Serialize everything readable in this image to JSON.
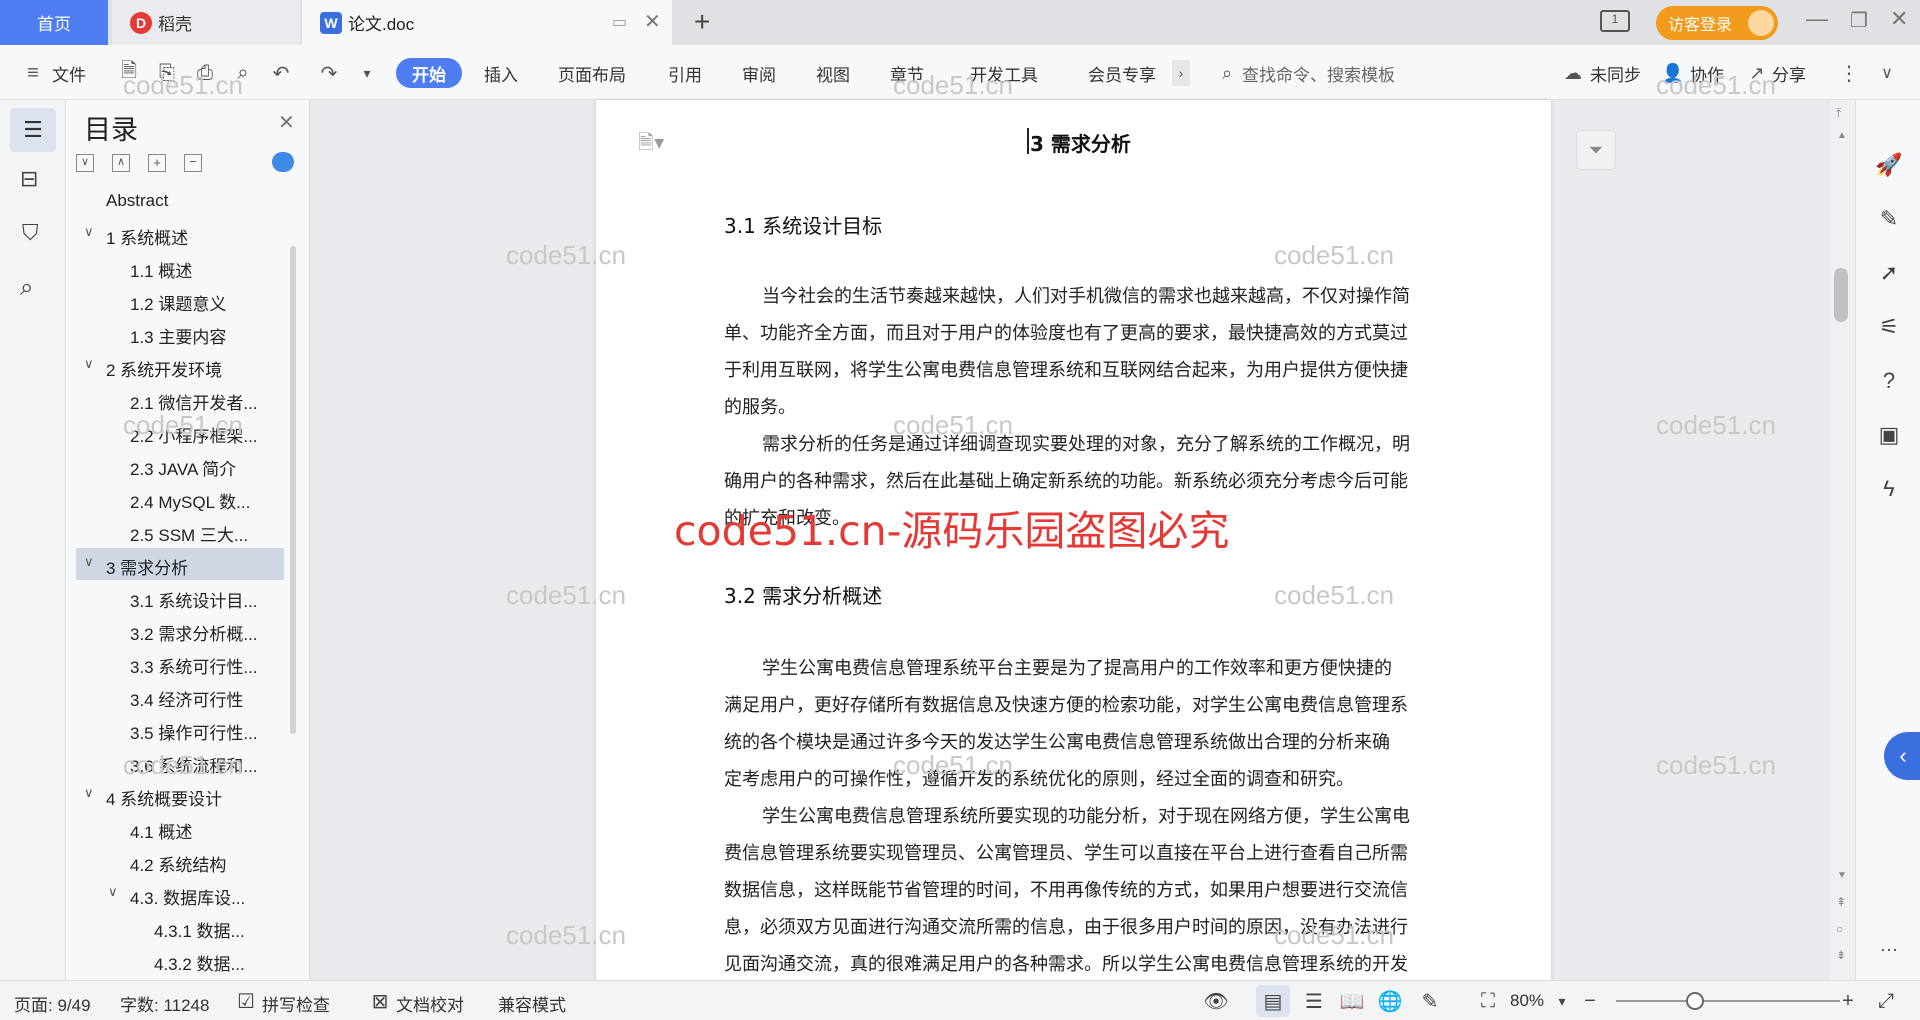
{
  "tabs": {
    "home": "首页",
    "daoke": "稻壳",
    "doc": "论文.doc",
    "new_tab": "+"
  },
  "titlebar": {
    "login": "访客登录"
  },
  "toolbar": {
    "file": "文件",
    "menus": [
      "开始",
      "插入",
      "页面布局",
      "引用",
      "审阅",
      "视图",
      "章节",
      "开发工具",
      "会员专享"
    ],
    "search_placeholder": "查找命令、搜索模板",
    "sync": "未同步",
    "collab": "协作",
    "share": "分享"
  },
  "toc": {
    "title": "目录",
    "items": [
      "Abstract",
      "1  系统概述",
      "1.1  概述",
      "1.2 课题意义",
      "1.3  主要内容",
      "2  系统开发环境",
      "2.1 微信开发者...",
      "2.2 小程序框架...",
      "2.3 JAVA 简介",
      "2.4 MySQL 数...",
      "2.5 SSM 三大...",
      "3  需求分析",
      "3.1  系统设计目...",
      "3.2 需求分析概...",
      "3.3  系统可行性...",
      "3.4 经济可行性",
      "3.5 操作可行性...",
      "3.6 系统流程和...",
      "4 系统概要设计",
      "4.1  概述",
      "4.2  系统结构",
      "4.3.  数据库设...",
      "4.3.1  数据...",
      "4.3.2  数据..."
    ]
  },
  "document": {
    "h1": "3  需求分析",
    "h2a": "3.1  系统设计目标",
    "p1": [
      "当今社会的生活节奏越来越快，人们对手机微信的需求也越来越高，不仅对操作简",
      "单、功能齐全方面，而且对于用户的体验度也有了更高的要求，最快捷高效的方式莫过",
      "于利用互联网，将学生公寓电费信息管理系统和互联网结合起来，为用户提供方便快捷",
      "的服务。"
    ],
    "p2": [
      "需求分析的任务是通过详细调查现实要处理的对象，充分了解系统的工作概况，明",
      "确用户的各种需求，然后在此基础上确定新系统的功能。新系统必须充分考虑今后可能",
      "的扩充和改变。"
    ],
    "h2b": "3.2 需求分析概述",
    "p3": [
      "学生公寓电费信息管理系统平台主要是为了提高用户的工作效率和更方便快捷的",
      "满足用户，更好存储所有数据信息及快速方便的检索功能，对学生公寓电费信息管理系",
      "统的各个模块是通过许多今天的发达学生公寓电费信息管理系统做出合理的分析来确",
      "定考虑用户的可操作性，遵循开发的系统优化的原则，经过全面的调查和研究。"
    ],
    "p4": [
      "学生公寓电费信息管理系统所要实现的功能分析，对于现在网络方便，学生公寓电",
      "费信息管理系统要实现管理员、公寓管理员、学生可以直接在平台上进行查看自己所需",
      "数据信息，这样既能节省管理的时间，不用再像传统的方式，如果用户想要进行交流信",
      "息，必须双方见面进行沟通交流所需的信息，由于很多用户时间的原因，没有办法进行",
      "见面沟通交流，真的很难满足用户的各种需求。所以学生公寓电费信息管理系统的开发"
    ],
    "watermark_small": "code51.cn",
    "watermark_big": "code51.cn-源码乐园盗图必究"
  },
  "status": {
    "page": "页面: 9/49",
    "words": "字数: 11248",
    "spell": "拼写检查",
    "proof": "文档校对",
    "compat": "兼容模式",
    "zoom": "80%"
  }
}
